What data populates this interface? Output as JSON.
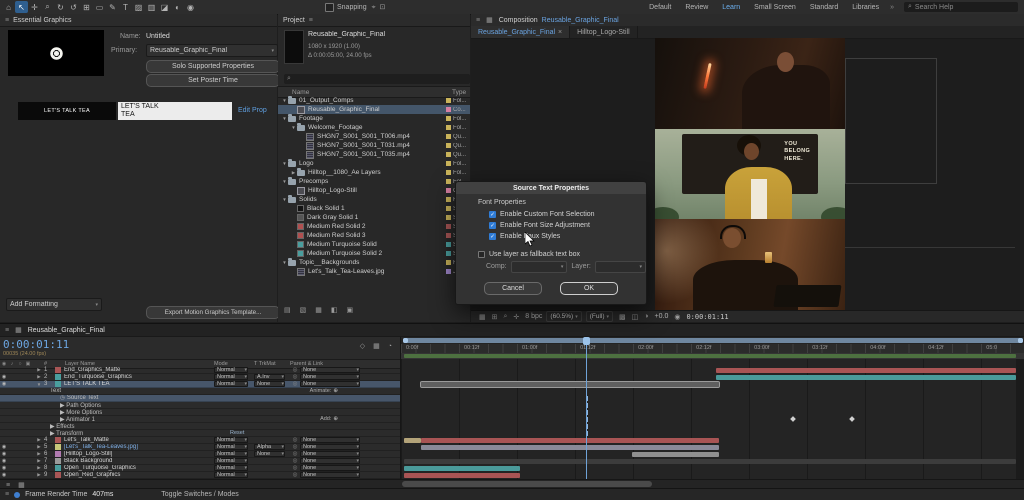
{
  "glyphs": {
    "caret": "▾",
    "menu": "≡",
    "search": "⌕",
    "close": "×",
    "arrow_right": "▶",
    "arrow_down": "▼",
    "target": "⊕",
    "pickwhip": "◎",
    "eye": "◉",
    "stopwatch": "◷",
    "check": "✓",
    "comp_tab": "▦",
    "camera": "◉"
  },
  "toolbar": {
    "tools": [
      {
        "name": "home-icon",
        "glyph": "⌂"
      },
      {
        "name": "selection-tool-icon",
        "glyph": "↖",
        "active": true
      },
      {
        "name": "hand-tool-icon",
        "glyph": "✛"
      },
      {
        "name": "zoom-tool-icon",
        "glyph": "⌕"
      },
      {
        "name": "orbit-camera-tool-icon",
        "glyph": "↻"
      },
      {
        "name": "rotation-tool-icon",
        "glyph": "↺"
      },
      {
        "name": "pan-behind-tool-icon",
        "glyph": "⊞"
      },
      {
        "name": "shape-tool-icon",
        "glyph": "▭"
      },
      {
        "name": "pen-tool-icon",
        "glyph": "✎"
      },
      {
        "name": "type-tool-icon",
        "glyph": "T"
      },
      {
        "name": "brush-tool-icon",
        "glyph": "▨"
      },
      {
        "name": "clone-stamp-tool-icon",
        "glyph": "▥"
      },
      {
        "name": "eraser-tool-icon",
        "glyph": "◪"
      },
      {
        "name": "roto-brush-tool-icon",
        "glyph": "◐"
      },
      {
        "name": "puppet-pin-tool-icon",
        "glyph": "◉"
      }
    ],
    "snapping_label": "Snapping",
    "snap_icons": [
      {
        "name": "snap-crosshair-icon",
        "glyph": "⌖"
      },
      {
        "name": "snap-grid-icon",
        "glyph": "⊡"
      }
    ],
    "workspaces": [
      "Default",
      "Review",
      "Learn",
      "Small Screen",
      "Standard",
      "Libraries"
    ],
    "active_workspace": "Learn",
    "overflow_glyph": "»",
    "search_placeholder": "Search Help"
  },
  "essential_graphics": {
    "tab_title": "Essential Graphics",
    "name_label": "Name:",
    "name_value": "Untitled",
    "primary_label": "Primary:",
    "primary_value": "Reusable_Graphic_Final",
    "solo_button_label": "Solo Supported Properties",
    "poster_button_label": "Set Poster Time",
    "preview_label_text": "LET'S TALK TEA",
    "preview_field_text": "LET'S TALK TEA",
    "edit_prop_label": "Edit Prop",
    "add_formatting_label": "Add Formatting",
    "export_button_label": "Export Motion Graphics Template..."
  },
  "project": {
    "tab_title": "Project",
    "comp_name": "Reusable_Graphic_Final",
    "info_line1": "1080 x 1920 (1.00)",
    "info_line2": "Δ 0:00:05:00, 24.00 fps",
    "columns": {
      "name": "Name",
      "type": "Type"
    },
    "rows": [
      {
        "name": "01_Output_Comps",
        "type": "Fol...",
        "icon": "folder",
        "indent": 0,
        "arrow": "down",
        "chip": "#c9b35a"
      },
      {
        "name": "Reusable_Graphic_Final",
        "type": "Co...",
        "icon": "comp",
        "indent": 1,
        "chip": "#d77fa2",
        "selected": true
      },
      {
        "name": "Footage",
        "type": "Fol...",
        "icon": "folder",
        "indent": 0,
        "arrow": "down",
        "chip": "#c9b35a"
      },
      {
        "name": "Welcome_Footage",
        "type": "Fol...",
        "icon": "folder",
        "indent": 1,
        "arrow": "down",
        "chip": "#c9b35a"
      },
      {
        "name": "SHGN7_S001_S001_T006.mp4",
        "type": "Qu...",
        "icon": "footage",
        "indent": 2,
        "chip": "#c9b35a"
      },
      {
        "name": "SHGN7_S001_S001_T031.mp4",
        "type": "Qu...",
        "icon": "footage",
        "indent": 2,
        "chip": "#c9b35a"
      },
      {
        "name": "SHGN7_S001_S001_T035.mp4",
        "type": "Qu...",
        "icon": "footage",
        "indent": 2,
        "chip": "#c9b35a"
      },
      {
        "name": "Logo",
        "type": "Fol...",
        "icon": "folder",
        "indent": 0,
        "arrow": "down",
        "chip": "#c9b35a"
      },
      {
        "name": "Hilltop__1080_Ae Layers",
        "type": "Fol...",
        "icon": "folder",
        "indent": 1,
        "arrow": "right",
        "chip": "#c9b35a"
      },
      {
        "name": "Precomps",
        "type": "Fol...",
        "icon": "folder",
        "indent": 0,
        "arrow": "down",
        "chip": "#c9b35a"
      },
      {
        "name": "Hilltop_Logo-Still",
        "type": "Co...",
        "icon": "comp",
        "indent": 1,
        "chip": "#d77fa2"
      },
      {
        "name": "Solids",
        "type": "Fol...",
        "icon": "folder",
        "indent": 0,
        "arrow": "down",
        "chip": "#c9b35a"
      },
      {
        "name": "Black Solid 1",
        "type": "So...",
        "icon": "solid",
        "solid_color": "#141414",
        "indent": 1,
        "chip": "#c9b35a"
      },
      {
        "name": "Dark Gray Solid 1",
        "type": "So...",
        "icon": "solid",
        "solid_color": "#555555",
        "indent": 1,
        "chip": "#c9b35a"
      },
      {
        "name": "Medium Red Solid 2",
        "type": "So...",
        "icon": "solid",
        "solid_color": "#b05050",
        "indent": 1,
        "chip": "#a85656"
      },
      {
        "name": "Medium Red Solid 3",
        "type": "So...",
        "icon": "solid",
        "solid_color": "#b05050",
        "indent": 1,
        "chip": "#a85656"
      },
      {
        "name": "Medium Turquoise Solid",
        "type": "So...",
        "icon": "solid",
        "solid_color": "#4a9e9e",
        "indent": 1,
        "chip": "#4a9e9e"
      },
      {
        "name": "Medium Turquoise Solid 2",
        "type": "So...",
        "icon": "solid",
        "solid_color": "#4a9e9e",
        "indent": 1,
        "chip": "#4a9e9e"
      },
      {
        "name": "Topic__Backgrounds",
        "type": "Fol...",
        "icon": "folder",
        "indent": 0,
        "arrow": "down",
        "chip": "#c9b35a"
      },
      {
        "name": "Let's_Talk_Tea-Leaves.jpg",
        "type": "JP...",
        "icon": "footage",
        "indent": 1,
        "chip": "#9f86c9"
      }
    ],
    "bottom_icons": [
      {
        "name": "interpret-footage-icon",
        "glyph": "▤"
      },
      {
        "name": "new-folder-icon",
        "glyph": "▧"
      },
      {
        "name": "new-composition-icon",
        "glyph": "▦"
      },
      {
        "name": "color-depth-icon",
        "glyph": "◧"
      },
      {
        "name": "delete-icon",
        "glyph": "▣"
      }
    ]
  },
  "composition": {
    "panel_tab_prefix": "Composition",
    "panel_tab_name": "Reusable_Graphic_Final",
    "viewer_tabs": [
      {
        "name": "Reusable_Graphic_Final",
        "active": true
      },
      {
        "name": "Hilltop_Logo-Still",
        "active": false
      }
    ],
    "frames": [
      {
        "name": "clip-sparkler-woman"
      },
      {
        "name": "clip-you-belong-here",
        "sign_line1": "YOU",
        "sign_line2": "BELONG",
        "sign_line3": "HERE."
      },
      {
        "name": "clip-headphones-toast"
      }
    ],
    "left_icons": [
      {
        "name": "layout-grid-icon",
        "glyph": "▦"
      },
      {
        "name": "ruler-icon",
        "glyph": "⊞"
      },
      {
        "name": "magnifier-icon",
        "glyph": "⌕"
      },
      {
        "name": "crosshair-icon",
        "glyph": "✛"
      }
    ],
    "mid_icons": [
      {
        "name": "transparency-grid-icon",
        "glyph": "▩"
      },
      {
        "name": "mask-visibility-icon",
        "glyph": "◫"
      },
      {
        "name": "fast-previews-icon",
        "glyph": "◑"
      }
    ],
    "controls": {
      "bit_depth": "8 bpc",
      "zoom": "(60.5%)",
      "resolution": "(Full)",
      "exposure": "+0.0",
      "timecode": "0:00:01:11"
    }
  },
  "dialog": {
    "title": "Source Text Properties",
    "section_label": "Font Properties",
    "checkboxes": [
      {
        "label": "Enable Custom Font Selection",
        "checked": true
      },
      {
        "label": "Enable Font Size Adjustment",
        "checked": true
      },
      {
        "label": "Enable Faux Styles",
        "checked": true
      }
    ],
    "fallback": {
      "label": "Use layer as fallback text box",
      "checked": false
    },
    "comp_label": "Comp:",
    "layer_label": "Layer:",
    "cancel_label": "Cancel",
    "ok_label": "OK"
  },
  "timeline": {
    "tab_title": "Reusable_Graphic_Final",
    "timecode": "0:00:01:11",
    "frame_info": "00035 (24.00 fps)",
    "columns": {
      "num": "#",
      "layer_name": "Layer Name",
      "mode": "Mode",
      "trkmat": "T TrkMat",
      "parent": "Parent & Link"
    },
    "reset_label": "Reset",
    "time_icons": [
      {
        "name": "comp-marker-bin-icon",
        "glyph": "◇"
      },
      {
        "name": "frame-blend-icon",
        "glyph": "▦"
      },
      {
        "name": "motion-blur-icon",
        "glyph": "◔"
      }
    ],
    "toggle_header_icons": [
      {
        "name": "eye-icon",
        "glyph": "◉"
      },
      {
        "name": "audio-icon",
        "glyph": "♪"
      },
      {
        "name": "solo-icon",
        "glyph": "○"
      },
      {
        "name": "lock-icon",
        "glyph": "▣"
      }
    ],
    "bottom_icons": [
      {
        "name": "expand-layers-icon",
        "glyph": "≡"
      },
      {
        "name": "graph-editor-icon",
        "glyph": "▦"
      }
    ],
    "rows": [
      {
        "kind": "layer",
        "num": "1",
        "name": "End_Graphics_Matte",
        "chip": "#a85656",
        "mode": "Normal",
        "trkmat": "",
        "parent": "None",
        "eye": false,
        "arrow": "right"
      },
      {
        "kind": "layer",
        "num": "2",
        "name": "End_Turquoise_Graphics",
        "chip": "#4a9e9e",
        "mode": "Normal",
        "trkmat": "A.Inv",
        "parent": "None",
        "eye": true,
        "arrow": "right"
      },
      {
        "kind": "layer",
        "num": "3",
        "name": "LET'S TALK TEA",
        "chip": "#4a9e9e",
        "mode": "Normal",
        "trkmat": "None",
        "parent": "None",
        "eye": true,
        "arrow": "down",
        "selected": true
      },
      {
        "kind": "group",
        "name": "Text",
        "indent": 1,
        "right_label": "Animate:",
        "right_name": "animate-label"
      },
      {
        "kind": "prop",
        "name": "Source Text",
        "indent": 2,
        "selected": true,
        "stopwatch": true
      },
      {
        "kind": "group",
        "name": "Path Options",
        "indent": 2,
        "arrow": "right"
      },
      {
        "kind": "group",
        "name": "More Options",
        "indent": 2,
        "arrow": "right"
      },
      {
        "kind": "group",
        "name": "Animator 1",
        "indent": 2,
        "arrow": "right",
        "right_label": "Add:",
        "right_name": "add-label"
      },
      {
        "kind": "group",
        "name": "Effects",
        "indent": 1,
        "arrow": "right"
      },
      {
        "kind": "group",
        "name": "Transform",
        "indent": 1,
        "arrow": "right",
        "reset": true
      },
      {
        "kind": "layer",
        "num": "4",
        "name": "Let's_Talk_Matte",
        "chip": "#a85656",
        "mode": "Normal",
        "trkmat": "",
        "parent": "None",
        "eye": false,
        "arrow": "right"
      },
      {
        "kind": "layer",
        "num": "5",
        "name": "[Let's_Talk_Tea-Leaves.jpg]",
        "chip": "#c7c77a",
        "mode": "Normal",
        "trkmat": "Alpha",
        "parent": "None",
        "eye": true,
        "arrow": "right",
        "blue": true
      },
      {
        "kind": "layer",
        "num": "6",
        "name": "[Hilltop_Logo-Still]",
        "chip": "#b07ab0",
        "mode": "Normal",
        "trkmat": "None",
        "parent": "None",
        "eye": true,
        "arrow": "right"
      },
      {
        "kind": "layer",
        "num": "7",
        "name": "Black Background",
        "chip": "#9a9a9a",
        "mode": "Normal",
        "trkmat": "",
        "parent": "None",
        "eye": true,
        "arrow": "right"
      },
      {
        "kind": "layer",
        "num": "8",
        "name": "Open_Turquoise_Graphics",
        "chip": "#4a9e9e",
        "mode": "Normal",
        "trkmat": "",
        "parent": "None",
        "eye": true,
        "arrow": "right"
      },
      {
        "kind": "layer",
        "num": "9",
        "name": "Open_Red_Graphics",
        "chip": "#a85656",
        "mode": "Normal",
        "trkmat": "",
        "parent": "None",
        "eye": true,
        "arrow": "right"
      }
    ],
    "ruler_labels": [
      "0:00f",
      "00:12f",
      "01:00f",
      "01:12f",
      "02:00f",
      "02:12f",
      "03:00f",
      "03:12f",
      "04:00f",
      "04:12f",
      "05:0"
    ],
    "ruler_start_pct": 0.8,
    "ruler_step_pct": 9.3,
    "playhead_pct": 29.6,
    "work_area": {
      "start": 0.5,
      "end": 98.5
    },
    "bars": [
      {
        "row": 0,
        "start": 50.5,
        "end": 98.5,
        "color": "#a85454"
      },
      {
        "row": 1,
        "start": 50.5,
        "end": 98.5,
        "color": "#4a9a9a"
      },
      {
        "row": 2,
        "start": 3.2,
        "end": 51,
        "color": "#5f5f5f",
        "selected": true
      },
      {
        "row": 10,
        "start": 0.5,
        "end": 3.2,
        "color": "#b3a379"
      },
      {
        "row": 10,
        "start": 3.2,
        "end": 51,
        "color": "#a85454"
      },
      {
        "row": 11,
        "start": 3.2,
        "end": 51,
        "color": "#8a8a98"
      },
      {
        "row": 12,
        "start": 37,
        "end": 51,
        "color": "#909090"
      },
      {
        "row": 13,
        "start": 0.5,
        "end": 98.5,
        "color": "#3c3c3c"
      },
      {
        "row": 14,
        "start": 0.5,
        "end": 19,
        "color": "#4a9a9a"
      },
      {
        "row": 15,
        "start": 0.5,
        "end": 19,
        "color": "#a85454"
      }
    ],
    "keyframes": {
      "row": 7,
      "positions": [
        62.5,
        72
      ]
    },
    "marker_rows": [
      4,
      5,
      6,
      7,
      8,
      9
    ]
  },
  "statusbar": {
    "render_label": "Frame Render Time",
    "render_value": "407ms",
    "toggle_label": "Toggle Switches / Modes"
  }
}
